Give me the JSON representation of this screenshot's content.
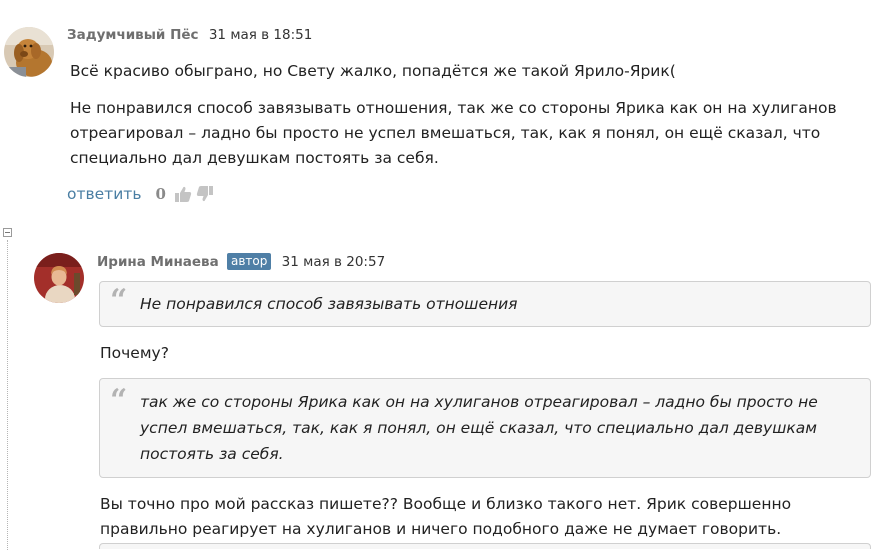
{
  "comments": [
    {
      "author": "Задумчивый Пёс",
      "date": "31 мая в 18:51",
      "paragraphs": [
        "Всё красиво обыграно, но Свету жалко, попадётся же такой Ярило-Ярик(",
        "Не понравился способ завязывать отношения, так же со стороны Ярика как он на хулиганов отреагировал – ладно бы просто не успел вмешаться, так, как я понял, он ещё сказал, что специально дал девушкам постоять за себя."
      ],
      "reply_label": "ответить",
      "score": "0",
      "avatar_icon": "dog-avatar-icon"
    },
    {
      "author": "Ирина Минаева",
      "badge": "автор",
      "date": "31 мая в 20:57",
      "quote1": "Не понравился способ завязывать отношения",
      "text1": "Почему?",
      "quote2": "так же со стороны Ярика как он на хулиганов отреагировал – ладно бы просто не успел вмешаться, так, как я понял, он ещё сказал, что специально дал девушкам постоять за себя.",
      "text2": "Вы точно про мой рассказ пишете?? Вообще и близко такого нет. Ярик совершенно правильно реагирует на хулиганов и ничего подобного даже не думает говорить.",
      "avatar_icon": "user-avatar-icon"
    }
  ],
  "icons": {
    "quote": "quote-icon",
    "like": "thumbs-up-icon",
    "dislike": "thumbs-down-icon",
    "collapse": "collapse-minus-icon"
  },
  "colors": {
    "link": "#4a7ea3",
    "badge": "#4f7fa6",
    "quote_bg": "#f6f6f6",
    "quote_border": "#d0d0d0"
  }
}
